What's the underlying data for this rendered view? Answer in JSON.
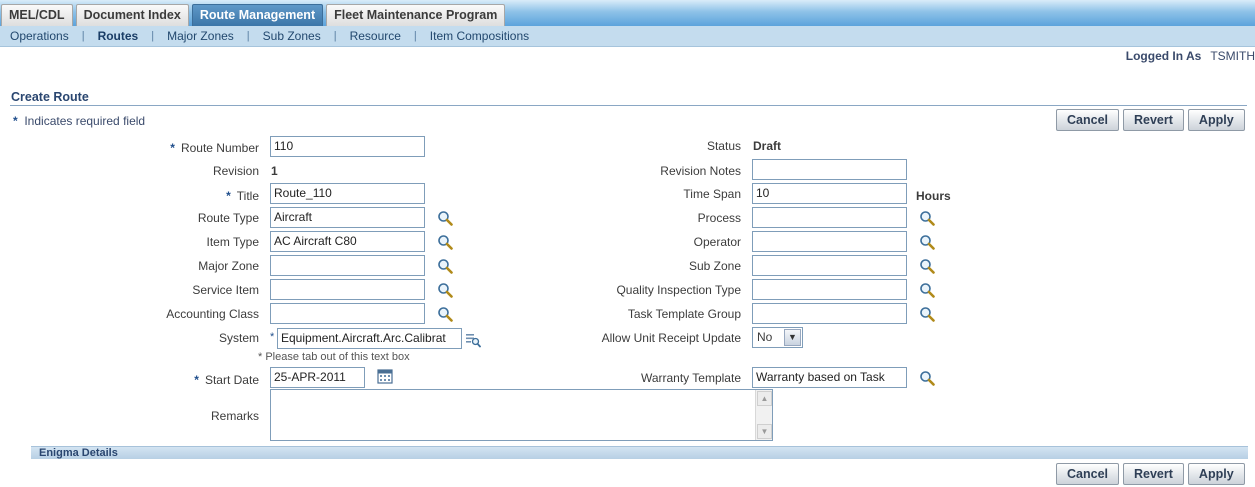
{
  "tabs": [
    {
      "label": "MEL/CDL"
    },
    {
      "label": "Document Index"
    },
    {
      "label": "Route Management"
    },
    {
      "label": "Fleet Maintenance Program"
    }
  ],
  "subnav": [
    {
      "label": "Operations"
    },
    {
      "label": "Routes"
    },
    {
      "label": "Major Zones"
    },
    {
      "label": "Sub Zones"
    },
    {
      "label": "Resource"
    },
    {
      "label": "Item Compositions"
    }
  ],
  "session": {
    "logged_in_label": "Logged In As",
    "user": "TSMITH"
  },
  "page": {
    "title": "Create Route",
    "required_note": "Indicates required field",
    "required_star": "*"
  },
  "buttons": {
    "cancel": "Cancel",
    "revert": "Revert",
    "apply": "Apply"
  },
  "form": {
    "route_number": {
      "label": "Route Number",
      "value": "110"
    },
    "revision": {
      "label": "Revision",
      "value": "1"
    },
    "title": {
      "label": "Title",
      "value": "Route_110"
    },
    "route_type": {
      "label": "Route Type",
      "value": "Aircraft"
    },
    "item_type": {
      "label": "Item Type",
      "value": "AC Aircraft C80"
    },
    "major_zone": {
      "label": "Major Zone",
      "value": ""
    },
    "service_item": {
      "label": "Service Item",
      "value": ""
    },
    "accounting_class": {
      "label": "Accounting Class",
      "value": ""
    },
    "system": {
      "label": "System",
      "value": "Equipment.Aircraft.Arc.Calibrat",
      "hint": "* Please tab out of this text box",
      "star": "*"
    },
    "start_date": {
      "label": "Start Date",
      "value": "25-APR-2011"
    },
    "remarks": {
      "label": "Remarks",
      "value": ""
    },
    "status": {
      "label": "Status",
      "value": "Draft"
    },
    "revision_notes": {
      "label": "Revision Notes",
      "value": ""
    },
    "time_span": {
      "label": "Time Span",
      "value": "10",
      "unit": "Hours"
    },
    "process": {
      "label": "Process",
      "value": ""
    },
    "operator": {
      "label": "Operator",
      "value": ""
    },
    "sub_zone": {
      "label": "Sub Zone",
      "value": ""
    },
    "quality_inspection_type": {
      "label": "Quality Inspection Type",
      "value": ""
    },
    "task_template_group": {
      "label": "Task Template Group",
      "value": ""
    },
    "allow_unit_receipt_update": {
      "label": "Allow Unit Receipt Update",
      "value": "No"
    },
    "warranty_template": {
      "label": "Warranty Template",
      "value": "Warranty based on Task"
    }
  },
  "sections": {
    "enigma_details": "Enigma Details"
  },
  "colors": {
    "active_tab": "#3c76a8",
    "subnav_bg": "#c4dcee",
    "title_color": "#2a4670"
  },
  "icons": {
    "lookup": "search-icon",
    "calendar": "calendar-icon",
    "system_lookup": "list-search-icon"
  }
}
